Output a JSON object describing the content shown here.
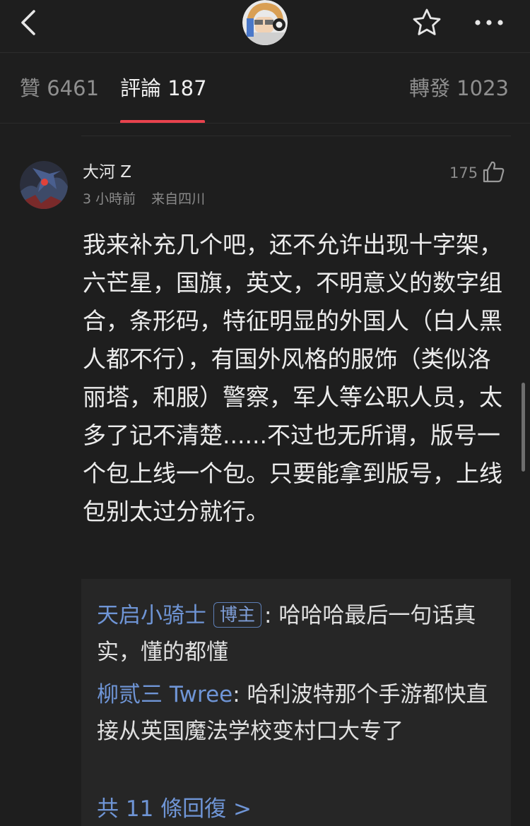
{
  "tabs": {
    "likes": "贊 6461",
    "comments": "評論 187",
    "reposts": "轉發 1023"
  },
  "icons": {
    "back": "chevron-left-icon",
    "favorite": "star-outline-icon",
    "more": "more-horizontal-icon",
    "like": "thumb-up-outline-icon"
  },
  "colors": {
    "background": "#1e1e1e",
    "accent": "#e8424d",
    "link": "#6f95d6",
    "reply_box": "#262626"
  },
  "comment": {
    "username": "大河 Z",
    "time": "3 小時前",
    "location": "来自四川",
    "likes": "175",
    "text": "我来补充几个吧，还不允许出现十字架，六芒星，国旗，英文，不明意义的数字组合，条形码，特征明显的外国人（白人黑人都不行），有国外风格的服饰（类似洛丽塔，和服）警察，军人等公职人员，太多了记不清楚......不过也无所谓，版号一个包上线一个包。只要能拿到版号，上线包别太过分就行。"
  },
  "replies": [
    {
      "name": "天启小骑士",
      "badge": "博主",
      "text": ": 哈哈哈最后一句话真实，懂的都懂"
    },
    {
      "name": "柳贰三 Twree",
      "text": ": 哈利波特那个手游都快直接从英国魔法学校变村口大专了"
    }
  ],
  "reply_count": "共 11 條回復 >"
}
